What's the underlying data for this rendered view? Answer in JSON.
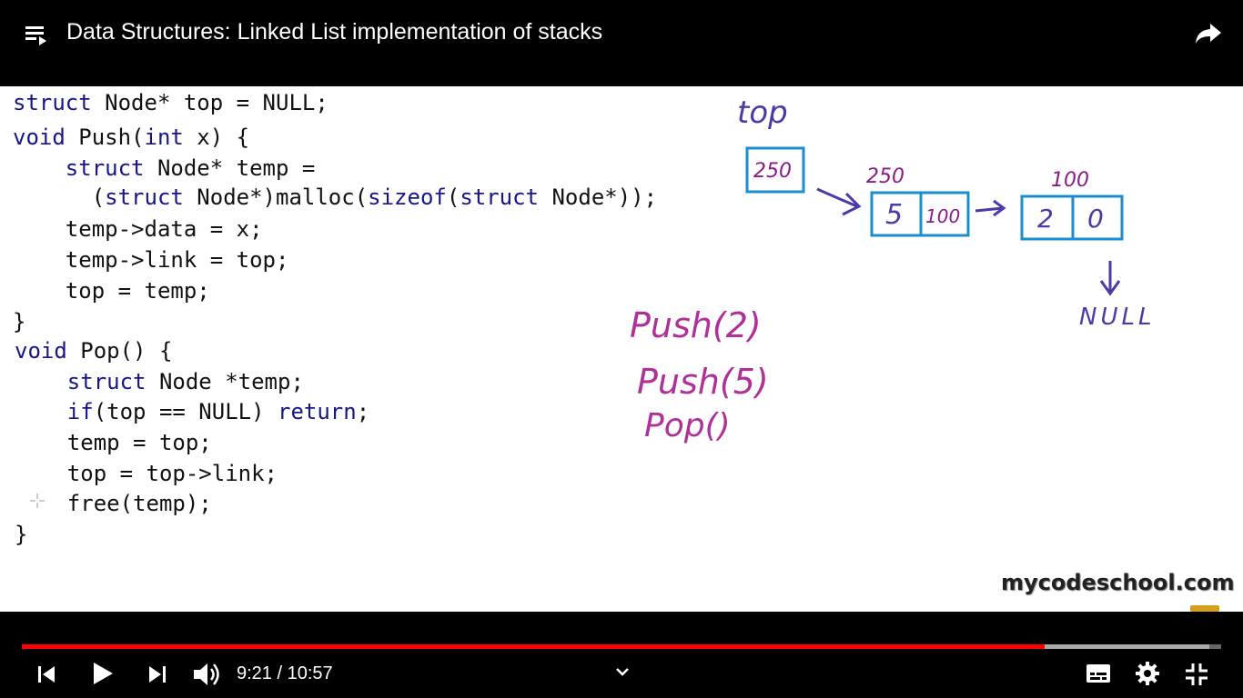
{
  "header": {
    "title": "Data Structures: Linked List implementation of stacks",
    "playlist_icon": "playlist-icon",
    "share_icon": "share-icon"
  },
  "code": {
    "lines": [
      "struct Node* top = NULL;",
      "void Push(int x) {",
      "    struct Node* temp =",
      "      (struct Node*)malloc(sizeof(struct Node*));",
      "    temp->data = x;",
      "    temp->link = top;",
      "    top = temp;",
      "}",
      "void Pop() {",
      "    struct Node *temp;",
      "    if(top == NULL) return;",
      "    temp = top;",
      "    top = top->link;",
      "    free(temp);",
      "}"
    ]
  },
  "diagram": {
    "top_label": "top",
    "top_value": "250",
    "node1_address": "250",
    "node1_data": "5",
    "node1_link": "100",
    "node2_address": "100",
    "node2_data": "2",
    "node2_link": "0",
    "null_label": "NULL"
  },
  "notes": {
    "op1": "Push(2)",
    "op2": "Push(5)",
    "op3": "Pop()"
  },
  "watermark": {
    "text": "mycodeschool.com"
  },
  "player": {
    "current_time": "9:21",
    "duration": "10:57",
    "time_separator": "/",
    "progress_fraction": 0.853,
    "buffered_fraction": 0.99,
    "accent_color": "#ff0000",
    "icons": [
      "previous-icon",
      "play-icon",
      "next-icon",
      "volume-icon",
      "chevron-down-icon",
      "captions-icon",
      "settings-icon",
      "exit-fullscreen-icon"
    ]
  }
}
